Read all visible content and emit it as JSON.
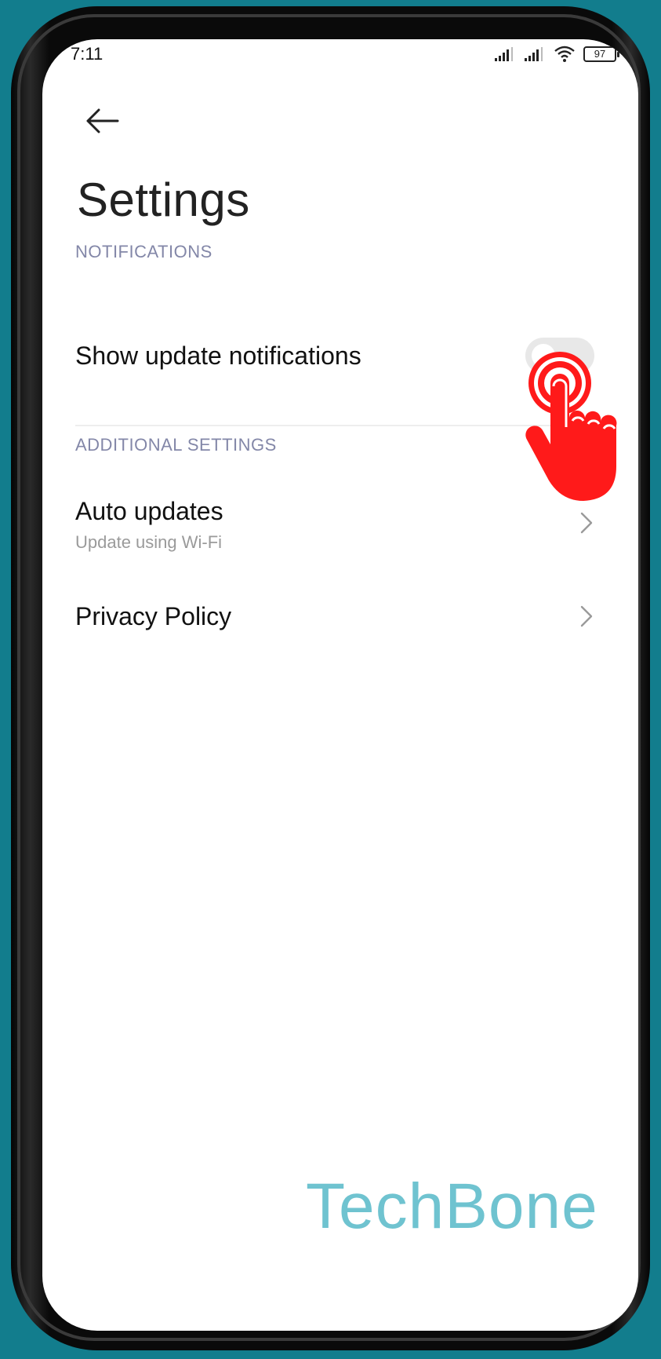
{
  "status_bar": {
    "time": "7:11",
    "battery": "97"
  },
  "header": {
    "title": "Settings"
  },
  "sections": {
    "notifications": {
      "header": "NOTIFICATIONS",
      "show_update_notifications": {
        "label": "Show update notifications",
        "enabled": false
      }
    },
    "additional": {
      "header": "ADDITIONAL SETTINGS",
      "auto_updates": {
        "label": "Auto updates",
        "subtitle": "Update using Wi-Fi"
      },
      "privacy_policy": {
        "label": "Privacy Policy"
      }
    }
  },
  "watermark": "TechBone",
  "colors": {
    "background": "#127d8d",
    "section_header": "#8387a8",
    "tap_indicator": "#ff1a1a",
    "watermark": "#6fc3d0"
  },
  "icons": {
    "back": "arrow-left-icon",
    "chevron": "chevron-right-icon",
    "tap": "tap-hand-icon"
  }
}
